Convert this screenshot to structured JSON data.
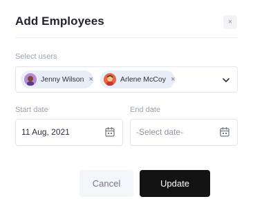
{
  "dialog": {
    "title": "Add Employees",
    "close_glyph": "×"
  },
  "select_users": {
    "label": "Select users",
    "selected": [
      {
        "name": "Jenny Wilson",
        "avatar_icon": "user-avatar-icon",
        "avatar_color": "#b889d6",
        "remove_glyph": "×"
      },
      {
        "name": "Arlene McCoy",
        "avatar_icon": "user-avatar-icon",
        "avatar_color": "#e8663a",
        "remove_glyph": "×"
      }
    ],
    "dropdown_icon": "chevron-down-icon"
  },
  "start_date": {
    "label": "Start date",
    "value": "11 Aug, 2021",
    "icon": "calendar-icon"
  },
  "end_date": {
    "label": "End date",
    "placeholder": "-Select date-",
    "icon": "calendar-icon"
  },
  "actions": {
    "cancel_label": "Cancel",
    "update_label": "Update"
  },
  "colors": {
    "primary_button": "#131313",
    "chip_background": "#e7eef8",
    "border": "#e2e6ec"
  }
}
